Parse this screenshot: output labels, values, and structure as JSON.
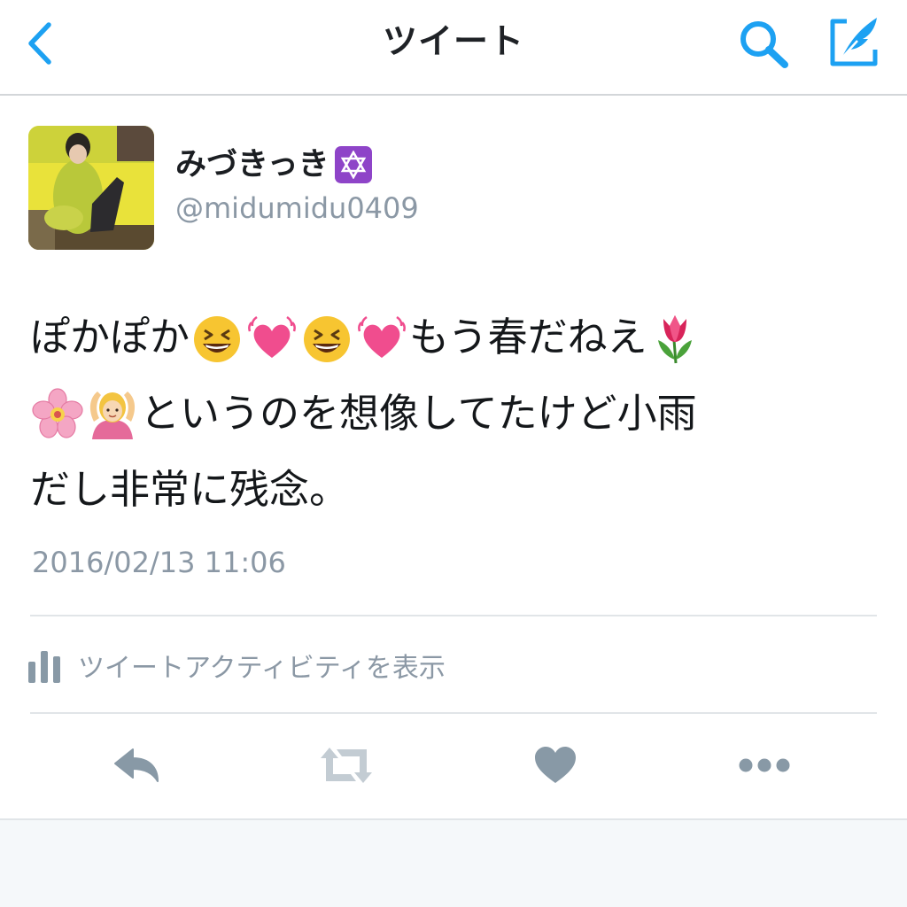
{
  "nav": {
    "title": "ツイート",
    "back_icon": "chevron-left-icon",
    "search_icon": "search-icon",
    "compose_icon": "compose-tweet-icon",
    "accent_color": "#1da1f2"
  },
  "author": {
    "display_name": "みづきっき",
    "name_badge_icon": "star-of-david-emoji",
    "handle": "@midumidu0409"
  },
  "tweet": {
    "line1_a": "ぽかぽか",
    "line1_b": "もう春だねえ",
    "line2": "というのを想像してたけど小雨",
    "line3": "だし非常に残念。",
    "timestamp": "2016/02/13 11:06"
  },
  "activity": {
    "label": "ツイートアクティビティを表示",
    "icon": "bar-chart-icon"
  },
  "actions": {
    "reply_icon": "reply-icon",
    "retweet_icon": "retweet-icon",
    "like_icon": "heart-icon",
    "more_icon": "more-dots-icon",
    "icon_color": "#8899a6"
  }
}
